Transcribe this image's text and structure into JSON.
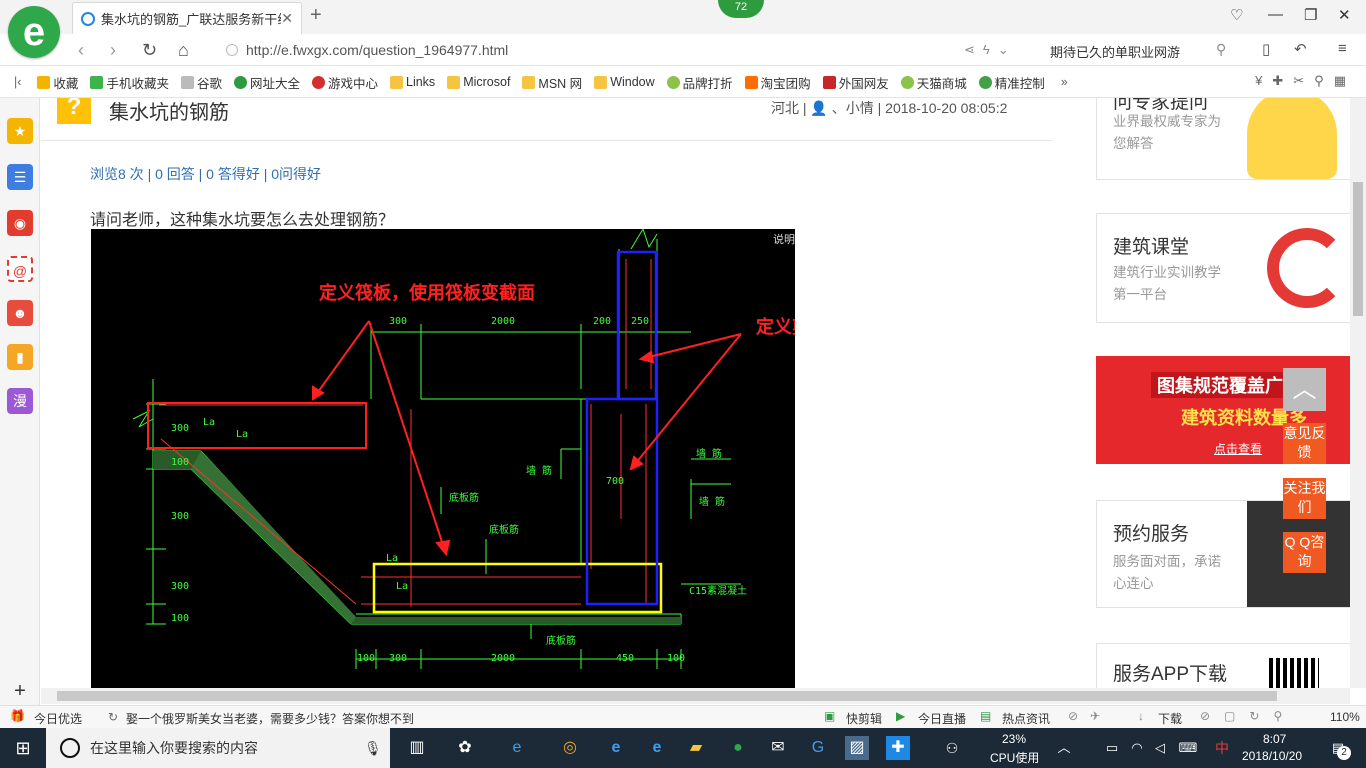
{
  "browser": {
    "badge": "72",
    "tab_title": "集水坑的钢筋_广联达服务新干线",
    "url": "http://e.fwxgx.com/question_1964977.html",
    "search_text": "期待已久的单职业网游",
    "win_min": "—",
    "win_max": "❐",
    "win_close": "✕",
    "new_tab": "+"
  },
  "bookmarks": [
    {
      "label": "收藏",
      "color": "#f2b400"
    },
    {
      "label": "手机收藏夹",
      "color": "#3cb44b"
    },
    {
      "label": "谷歌",
      "color": "#bbbbbb"
    },
    {
      "label": "网址大全",
      "color": "#2e9b3f"
    },
    {
      "label": "游戏中心",
      "color": "#d32f2f"
    },
    {
      "label": "Links",
      "color": "#f5c542"
    },
    {
      "label": "Microsof",
      "color": "#f5c542"
    },
    {
      "label": "MSN 网",
      "color": "#f5c542"
    },
    {
      "label": "Window",
      "color": "#f5c542"
    },
    {
      "label": "品牌打折",
      "color": "#8bc34a"
    },
    {
      "label": "淘宝团购",
      "color": "#ff6d00"
    },
    {
      "label": "外国网友",
      "color": "#c62828"
    },
    {
      "label": "天猫商城",
      "color": "#8bc34a"
    },
    {
      "label": "精准控制",
      "color": "#43a047"
    }
  ],
  "page": {
    "title": "集水坑的钢筋",
    "meta": "河北 | 👤 、小情 | 2018-10-20 08:05:2",
    "stats": "浏览8 次 | 0 回答 | 0 答得好 | 0问得好",
    "question": "请问老师，这种集水坑要怎么去处理钢筋？"
  },
  "cad": {
    "note1": "定义筏板，使用筏板变截面",
    "note2": "定义剪力墙",
    "top_dims": [
      "300",
      "2000",
      "200",
      "250"
    ],
    "bottom_dims": [
      "100",
      "300",
      "2000",
      "450",
      "100"
    ],
    "left_dims": [
      "300",
      "100",
      "300",
      "300",
      "100"
    ],
    "wall_dim": "700",
    "rebar_wall1": "墙 筋",
    "rebar_wall2": "墙 筋",
    "rebar_wall3": "墙 筋",
    "rebar_bottom1": "底板筋",
    "rebar_bottom2": "底板筋",
    "rebar_bottom3": "底板筋",
    "la1": "La",
    "la2": "La",
    "la3": "La",
    "la4": "La",
    "c15": "C15素混凝土",
    "corner": "说明"
  },
  "right": {
    "card1_title": "问专家提问",
    "card1_sub": "业界最权威专家为您解答",
    "card2_title": "建筑课堂",
    "card2_sub": "建筑行业实训教学第一平台",
    "ad_line1": "图集规范覆盖广",
    "ad_line2": "建筑资料数量多",
    "ad_link": "点击查看",
    "card3_title": "预约服务",
    "card3_sub": "服务面对面，承诺心连心",
    "card4_title": "服务APP下载",
    "float1": "意见反馈",
    "float2": "关注我们",
    "float3": "Q Q咨询"
  },
  "statusbar": {
    "left1": "今日优选",
    "news": "娶一个俄罗斯美女当老婆，需要多少钱？答案你想不到",
    "r1": "快剪辑",
    "r2": "今日直播",
    "r3": "热点资讯",
    "r4": "下载",
    "zoom": "110%"
  },
  "taskbar": {
    "search_placeholder": "在这里输入你要搜索的内容",
    "cpu_pct": "23%",
    "cpu_label": "CPU使用",
    "ime": "中",
    "time": "8:07",
    "date": "2018/10/20",
    "notif": "2"
  }
}
